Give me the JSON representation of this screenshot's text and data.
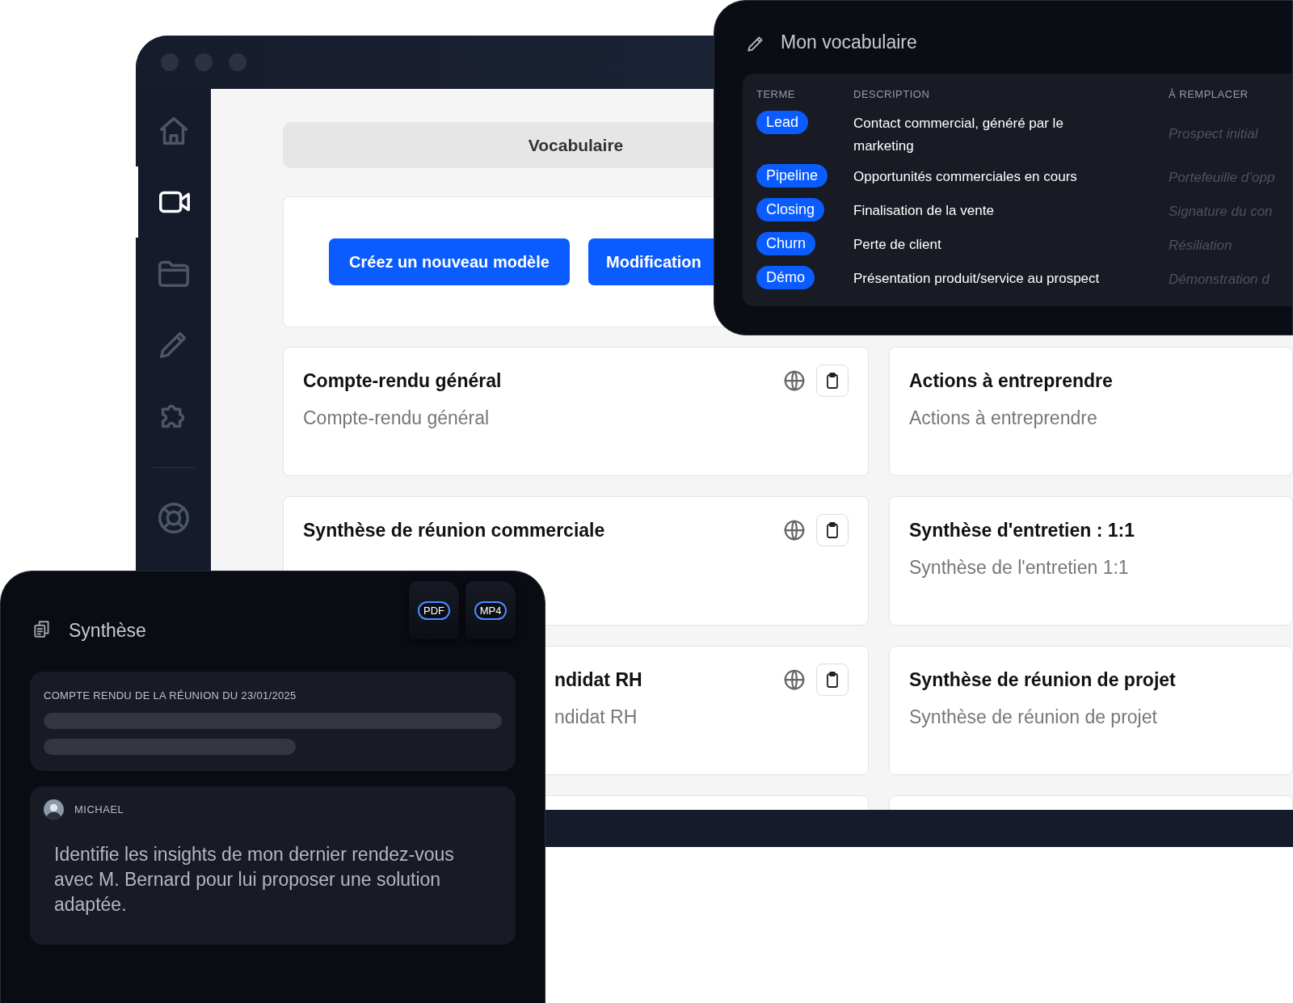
{
  "main_window": {
    "sidebar": {
      "items": [
        {
          "kind": "home",
          "selected": false
        },
        {
          "kind": "video",
          "selected": true
        },
        {
          "kind": "folder",
          "selected": false
        },
        {
          "kind": "pencil",
          "selected": false
        },
        {
          "kind": "puzzle",
          "selected": false
        },
        {
          "kind": "lifebuoy",
          "selected": false
        }
      ]
    },
    "tab": {
      "label": "Vocabulaire"
    },
    "buttons": [
      "Créez un nouveau modèle",
      "Modification"
    ],
    "templates": [
      {
        "title": "Compte-rendu général",
        "description": "Compte-rendu général",
        "has_actions": true,
        "covered": false
      },
      {
        "title": "Actions à entreprendre",
        "description": "Actions à entreprendre",
        "has_actions": false,
        "covered": false
      },
      {
        "title": "Synthèse de réunion commerciale",
        "has_actions": true,
        "covered": false
      },
      {
        "title": "Synthèse d'entretien : 1:1",
        "description": "Synthèse de l'entretien 1:1",
        "has_actions": false,
        "covered": false
      },
      {
        "title": "ndidat RH",
        "description": "ndidat RH",
        "has_actions": true,
        "covered": true
      },
      {
        "title": "Synthèse de réunion de projet",
        "description": "Synthèse de réunion de projet",
        "has_actions": false,
        "covered": false
      }
    ]
  },
  "vocabulary_window": {
    "title": "Mon vocabulaire",
    "columns": [
      "TERME",
      "DESCRIPTION",
      "À REMPLACER"
    ],
    "rows": [
      {
        "term": "Lead",
        "description": "Contact commercial, généré par le\nmarketing",
        "replacement": "Prospect initial"
      },
      {
        "term": "Pipeline",
        "description": "Opportunités commerciales en cours",
        "replacement": "Portefeuille d’opp"
      },
      {
        "term": "Closing",
        "description": "Finalisation de la vente",
        "replacement": "Signature du con"
      },
      {
        "term": "Churn",
        "description": "Perte de client",
        "replacement": "Résiliation"
      },
      {
        "term": "Démo",
        "description": "Présentation produit/service au prospect",
        "replacement": "Démonstration d"
      }
    ]
  },
  "summary_window": {
    "title": "Synthèse",
    "files": [
      "PDF",
      "MP4"
    ],
    "report": {
      "heading": "COMPTE RENDU DE LA RÉUNION DU 23/01/2025"
    },
    "message": {
      "author": "MICHAEL",
      "text": "Identifie les insights de mon dernier rendez-vous avec M. Bernard pour lui proposer une solution adaptée."
    }
  }
}
